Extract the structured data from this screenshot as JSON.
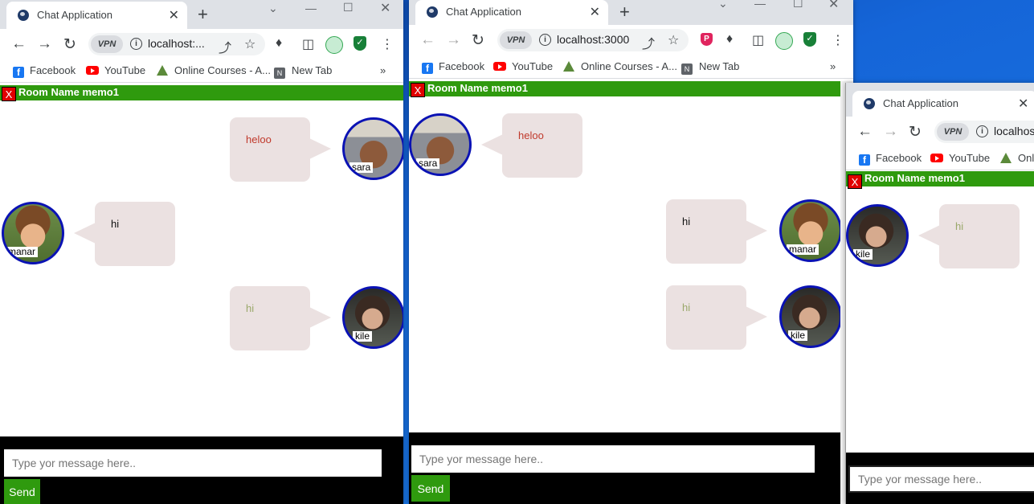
{
  "browser": {
    "tab_title": "Chat Application",
    "url_1": "localhost:...",
    "url_2": "localhost:3000",
    "url_3": "localhos",
    "new_tab_symbol": "+",
    "tab_close_symbol": "✕",
    "bookmarks": [
      "Facebook",
      "YouTube",
      "Online Courses - A...",
      "New Tab"
    ],
    "bookmark_3_short": "Onl",
    "bookmarks_more": "»",
    "vpn_label": "VPN"
  },
  "chat": {
    "close_label": "X",
    "room_title": "Room Name memo1",
    "input_placeholder": "Type yor message here..",
    "send_label": "Send"
  },
  "window1": {
    "messages": [
      {
        "user": "sara",
        "text": "heloo",
        "side": "right",
        "color": "#c0392b"
      },
      {
        "user": "manar",
        "text": "hi",
        "side": "left",
        "color": "#111111"
      },
      {
        "user": "kile",
        "text": "hi",
        "side": "right",
        "color": "#9aa86a"
      }
    ]
  },
  "window2": {
    "messages": [
      {
        "user": "sara",
        "text": "heloo",
        "side": "left",
        "color": "#c0392b"
      },
      {
        "user": "manar",
        "text": "hi",
        "side": "right",
        "color": "#111111"
      },
      {
        "user": "kile",
        "text": "hi",
        "side": "right",
        "color": "#9aa86a"
      }
    ]
  },
  "window3": {
    "messages": [
      {
        "user": "kile",
        "text": "hi",
        "side": "left",
        "color": "#9aa86a"
      }
    ]
  },
  "colors": {
    "room_bar": "#2f9a0e",
    "avatar_border": "#0a12b4",
    "bubble": "#ebe1e1"
  }
}
